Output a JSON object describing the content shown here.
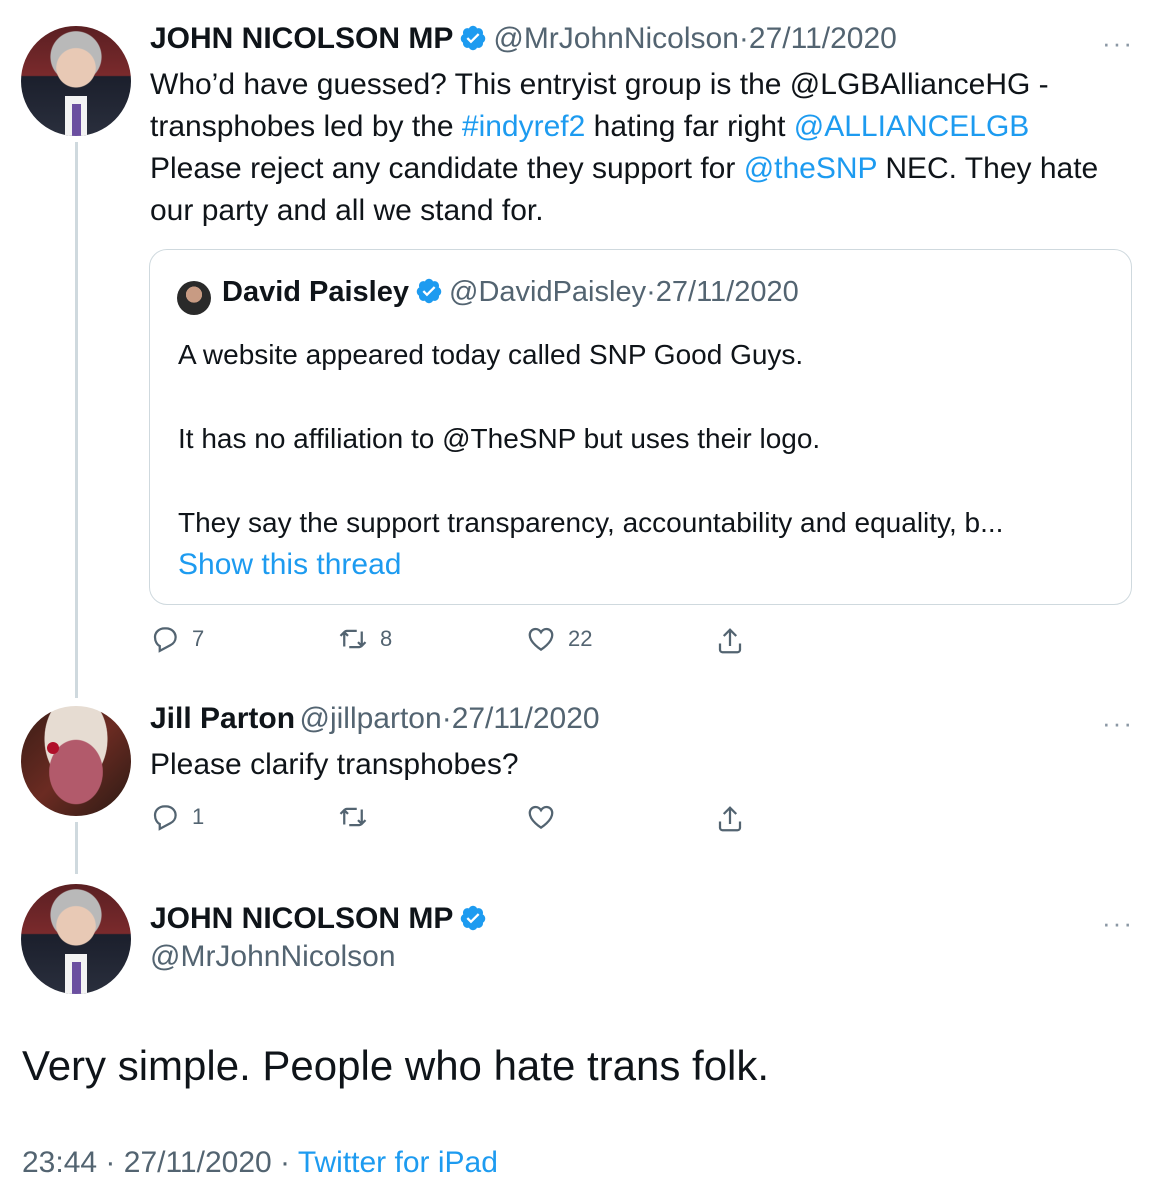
{
  "tweet1": {
    "name": "JOHN NICOLSON MP",
    "handle": "@MrJohnNicolson",
    "sep": "·",
    "date": "27/11/2020",
    "more": "···",
    "text": {
      "l1": "Who’d have guessed? This entryist group is the @LGBAllianceHG -",
      "l2a": "transphobes led by the ",
      "l2b": "#indyref2",
      "l2c": " hating far right ",
      "l2d": "@ALLIANCELGB",
      "l3a": "Please reject any candidate they support for ",
      "l3b": "@theSNP",
      "l3c": " NEC. They hate",
      "l4": "our party and all we stand for."
    },
    "quote": {
      "name": "David Paisley",
      "handle": "@DavidPaisley",
      "sep": "·",
      "date": "27/11/2020",
      "p1": "A website appeared today called SNP Good Guys.",
      "p2": "It has no affiliation to @TheSNP but uses their logo.",
      "p3": "They say the support transparency, accountability and equality, b...",
      "show_thread": "Show this thread"
    },
    "actions": {
      "replies": "7",
      "retweets": "8",
      "likes": "22"
    }
  },
  "tweet2": {
    "name": "Jill Parton",
    "handle": "@jillparton",
    "sep": "·",
    "date": "27/11/2020",
    "more": "···",
    "text": "Please clarify transphobes?",
    "actions": {
      "replies": "1"
    }
  },
  "main": {
    "name": "JOHN NICOLSON MP",
    "handle": "@MrJohnNicolson",
    "more": "···",
    "text": "Very simple. People who hate trans folk.",
    "time": "23:44",
    "sep1": "·",
    "date": "27/11/2020",
    "sep2": "·",
    "source": "Twitter for iPad"
  },
  "colors": {
    "link": "#1d9bf0",
    "muted": "#536471",
    "border": "#cfd9de",
    "verified": "#1d9bf0"
  },
  "icons": [
    "verified-icon",
    "more-icon",
    "reply-icon",
    "retweet-icon",
    "like-icon",
    "share-icon"
  ]
}
